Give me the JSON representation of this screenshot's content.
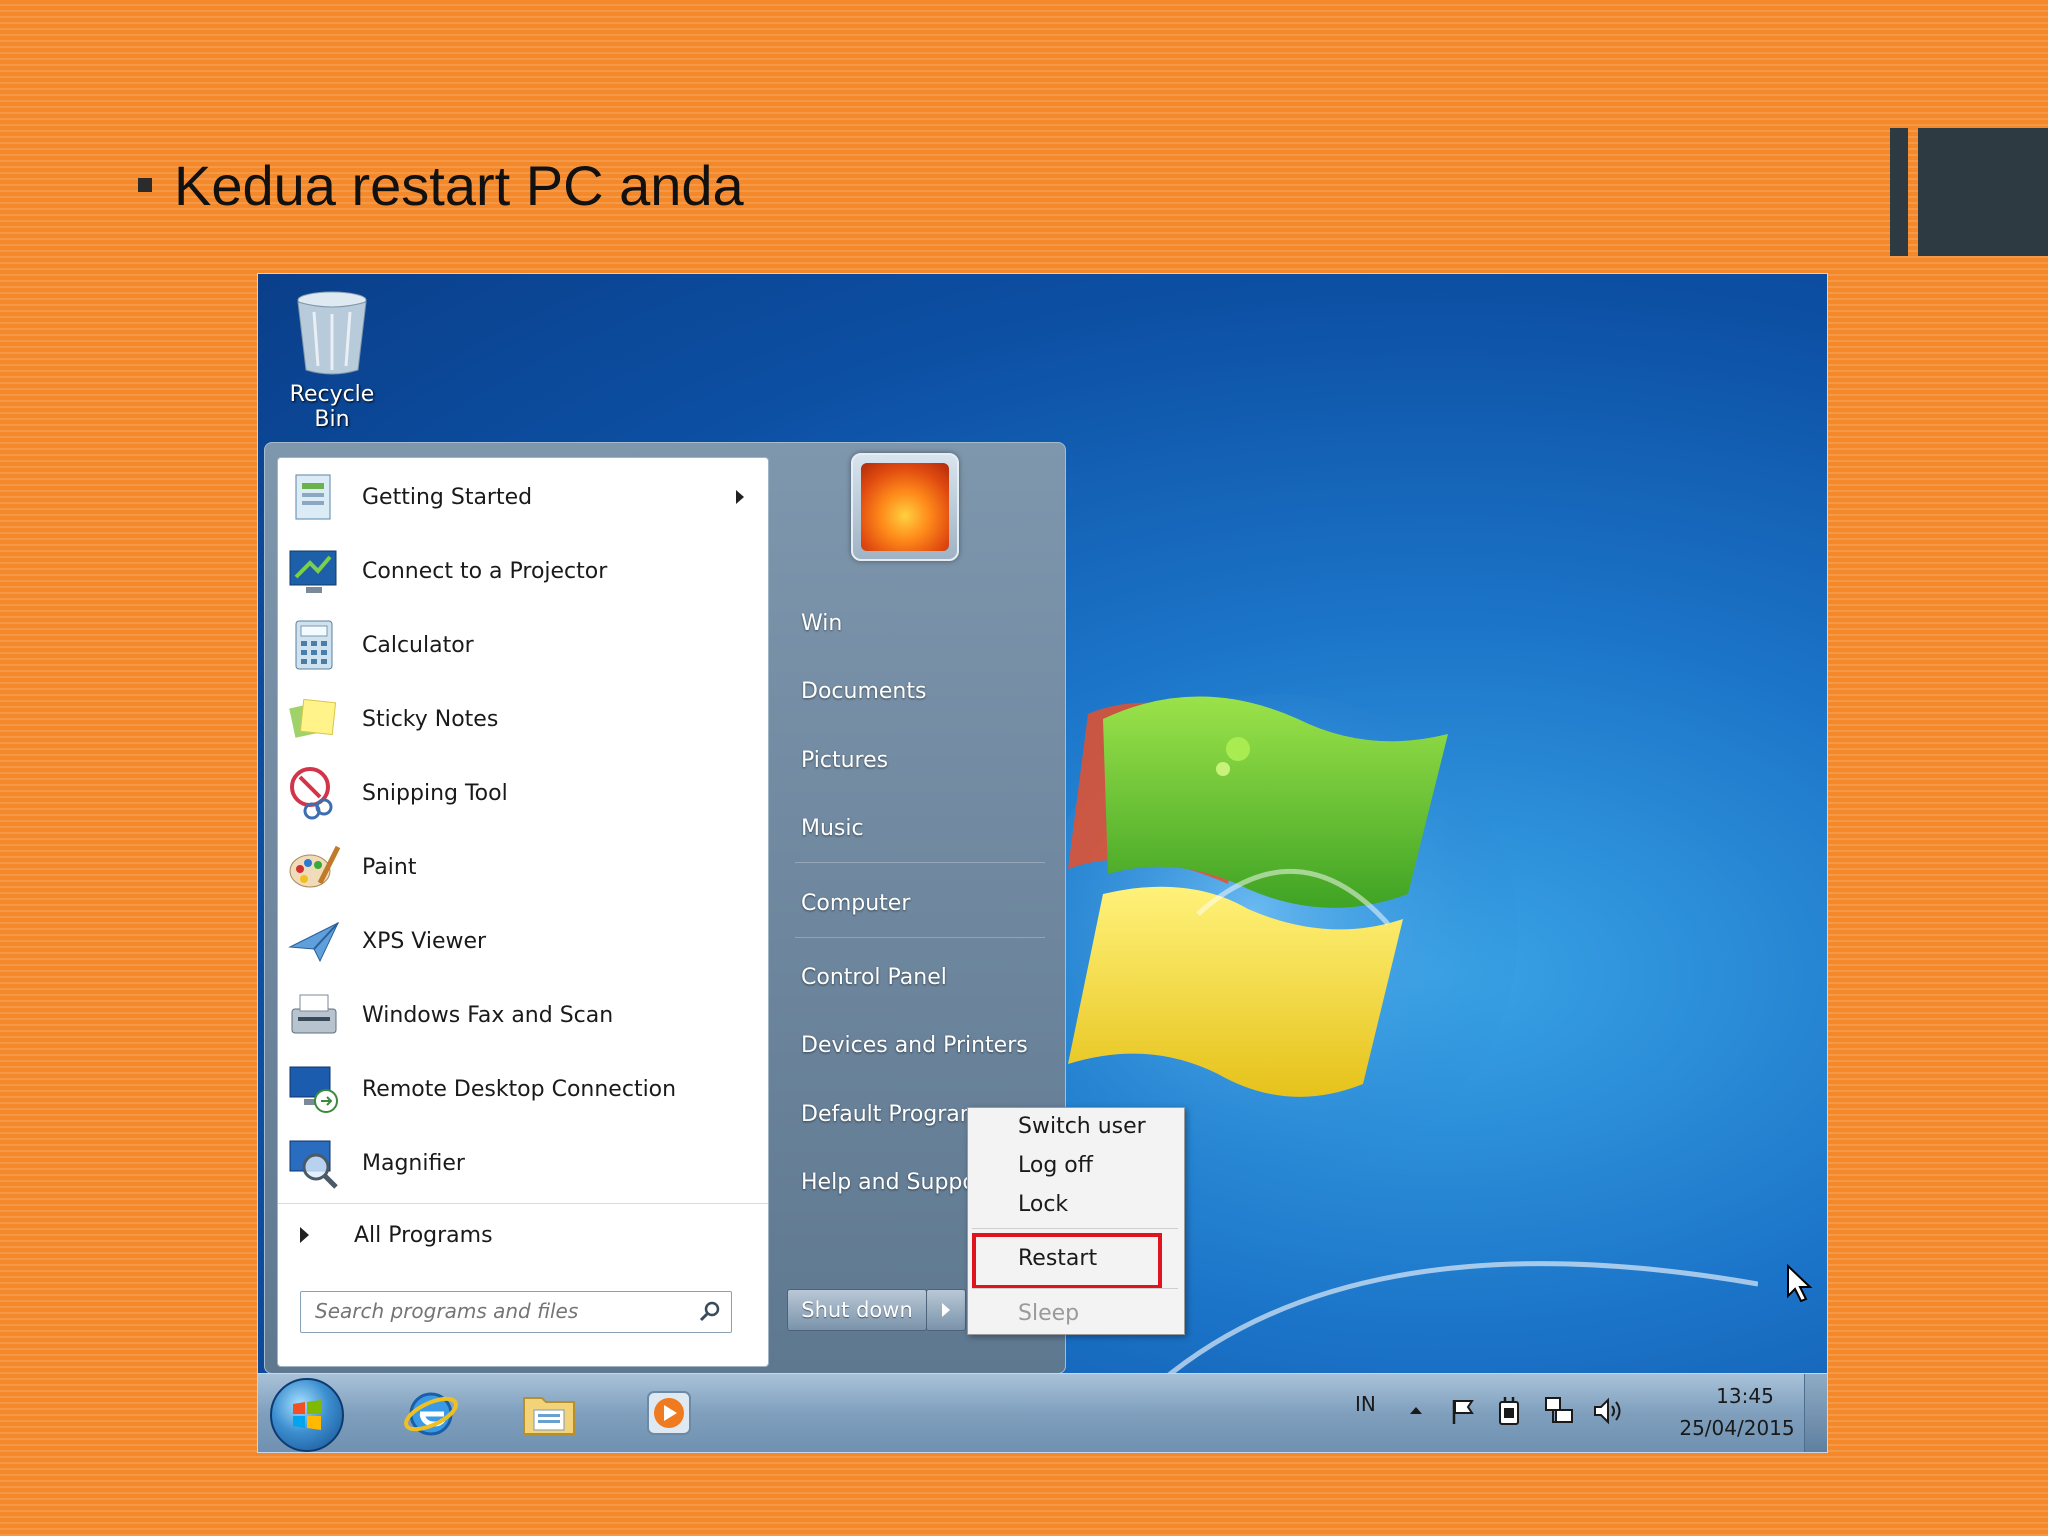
{
  "slide": {
    "title": "Kedua restart PC anda"
  },
  "desktop": {
    "recycle_bin_label": "Recycle Bin"
  },
  "start_menu": {
    "programs": [
      {
        "label": "Getting Started",
        "icon": "getting-started-icon",
        "has_submenu": true
      },
      {
        "label": "Connect to a Projector",
        "icon": "projector-icon"
      },
      {
        "label": "Calculator",
        "icon": "calculator-icon"
      },
      {
        "label": "Sticky Notes",
        "icon": "sticky-notes-icon"
      },
      {
        "label": "Snipping Tool",
        "icon": "snipping-tool-icon"
      },
      {
        "label": "Paint",
        "icon": "paint-icon"
      },
      {
        "label": "XPS Viewer",
        "icon": "xps-viewer-icon"
      },
      {
        "label": "Windows Fax and Scan",
        "icon": "fax-scan-icon"
      },
      {
        "label": "Remote Desktop Connection",
        "icon": "remote-desktop-icon"
      },
      {
        "label": "Magnifier",
        "icon": "magnifier-icon"
      }
    ],
    "all_programs": "All Programs",
    "search_placeholder": "Search programs and files",
    "right_links": [
      "Win",
      "Documents",
      "Pictures",
      "Music",
      "Computer",
      "Control Panel",
      "Devices and Printers",
      "Default Program",
      "Help and Suppo"
    ],
    "shutdown_label": "Shut down"
  },
  "shutdown_menu": {
    "items": [
      "Switch user",
      "Log off",
      "Lock",
      "Restart",
      "Sleep"
    ],
    "highlighted": "Restart",
    "disabled": "Sleep",
    "highlight_color": "#e0131f"
  },
  "taskbar": {
    "language": "IN",
    "time": "13:45",
    "date": "25/04/2015",
    "pinned": [
      "internet-explorer-icon",
      "windows-explorer-icon",
      "media-player-icon"
    ]
  },
  "colors": {
    "slide_background": "#f5892a",
    "accent_dark": "#2e3a42",
    "desktop_blue": "#1c75c9"
  }
}
